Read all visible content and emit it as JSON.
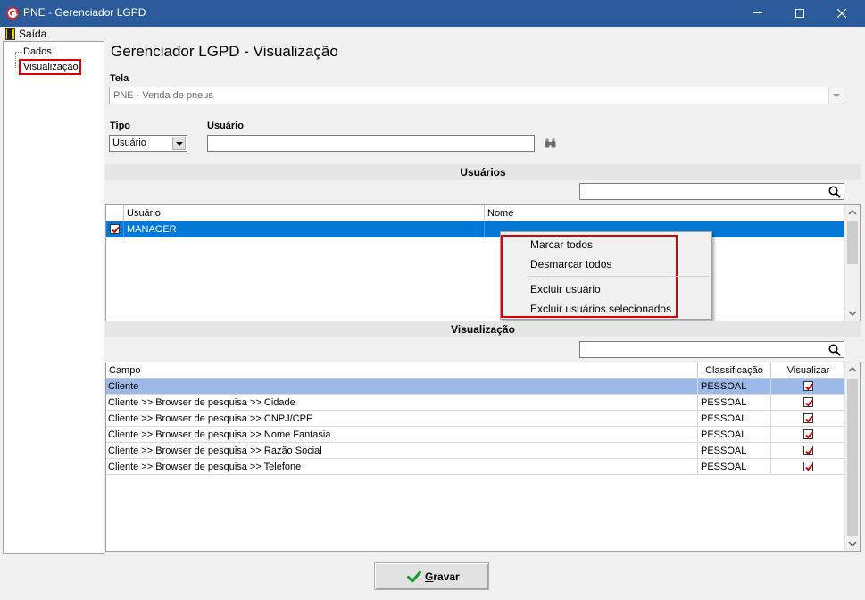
{
  "window": {
    "title": "PNE - Gerenciador LGPD"
  },
  "menubar": {
    "exit_label": "Saída"
  },
  "tree": {
    "items": [
      {
        "label": "Dados"
      },
      {
        "label": "Visualização",
        "highlighted": true
      }
    ]
  },
  "page": {
    "title": "Gerenciador LGPD - Visualização",
    "tela_label": "Tela",
    "tela_value": "PNE - Venda de pneus",
    "tipo_label": "Tipo",
    "tipo_value": "Usuário",
    "usuario_label": "Usuário",
    "usuario_value": ""
  },
  "usuarios_section": {
    "title": "Usuários",
    "search_value": "",
    "columns": [
      "Usuário",
      "Nome"
    ],
    "rows": [
      {
        "checked": true,
        "usuario": "MANAGER",
        "nome": "",
        "selected": true
      }
    ]
  },
  "context_menu": {
    "items": [
      {
        "label": "Marcar todos"
      },
      {
        "label": "Desmarcar todos"
      },
      {
        "label": "Excluir usuário"
      },
      {
        "label": "Excluir usuários selecionados"
      }
    ]
  },
  "visualizacao_section": {
    "title": "Visualização",
    "search_value": "",
    "columns": [
      "Campo",
      "Classificação",
      "Visualizar"
    ],
    "rows": [
      {
        "campo": "Cliente",
        "classificacao": "PESSOAL",
        "visualizar": true,
        "selected": true
      },
      {
        "campo": "Cliente >> Browser de pesquisa >> Cidade",
        "classificacao": "PESSOAL",
        "visualizar": true
      },
      {
        "campo": "Cliente >> Browser de pesquisa >> CNPJ/CPF",
        "classificacao": "PESSOAL",
        "visualizar": true
      },
      {
        "campo": "Cliente >> Browser de pesquisa >> Nome Fantasia",
        "classificacao": "PESSOAL",
        "visualizar": true
      },
      {
        "campo": "Cliente >> Browser de pesquisa >> Razão Social",
        "classificacao": "PESSOAL",
        "visualizar": true
      },
      {
        "campo": "Cliente >> Browser de pesquisa >> Telefone",
        "classificacao": "PESSOAL",
        "visualizar": true
      }
    ]
  },
  "footer": {
    "save_label": "Gravar"
  },
  "colors": {
    "titlebar": "#2c5b9c",
    "selection_blue": "#0078d7",
    "selection_light": "#9cb9e7",
    "highlight_red": "#e00000",
    "checkbox_red": "#d00000",
    "save_check_green": "#1a9a2a"
  }
}
